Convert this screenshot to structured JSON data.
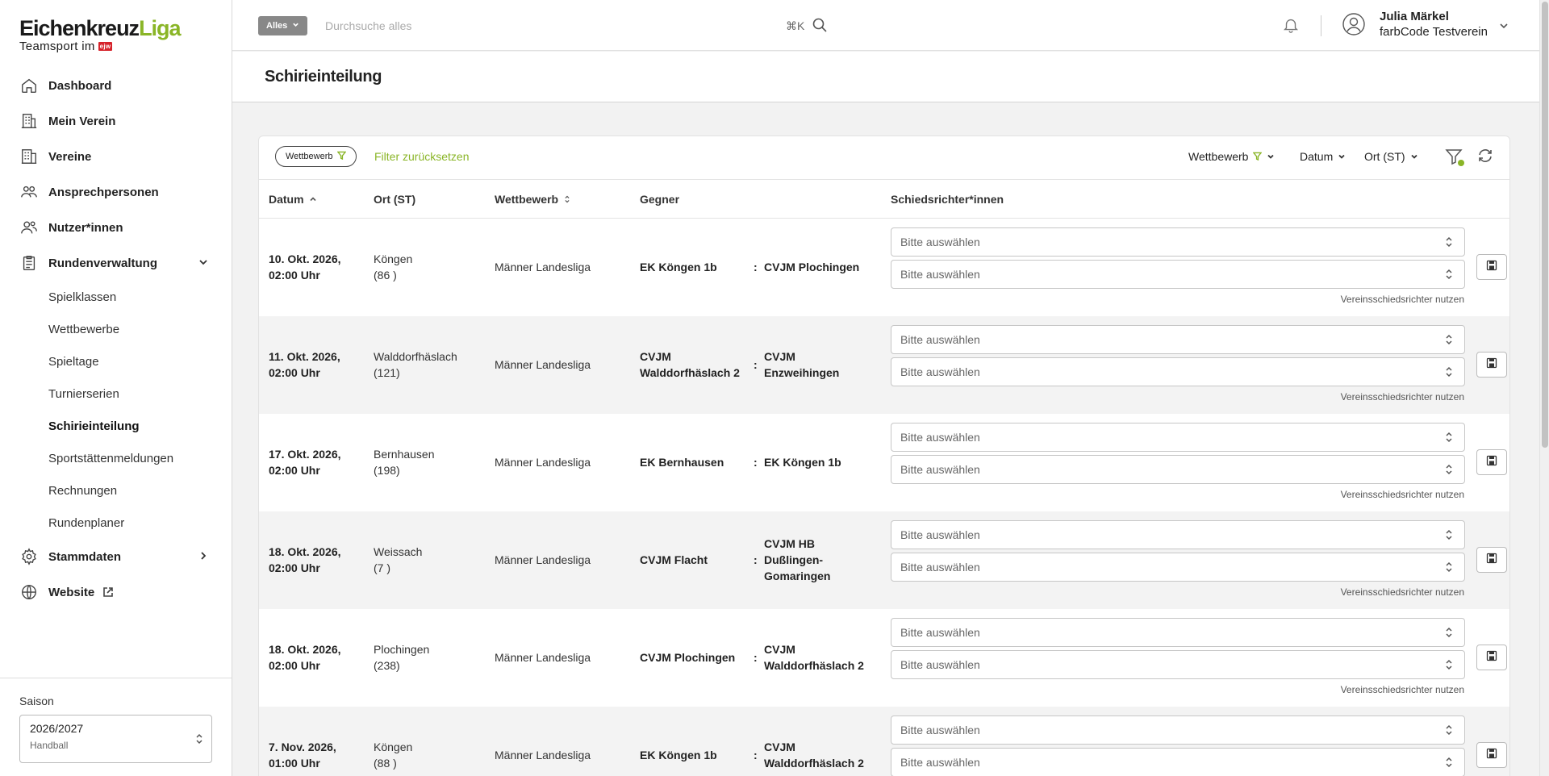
{
  "logo": {
    "brand_a": "Eichenkreuz",
    "brand_b": "Liga",
    "tagline": "Teamsport im",
    "badge": "ejw"
  },
  "nav": {
    "items": [
      {
        "label": "Dashboard",
        "icon": "home-icon"
      },
      {
        "label": "Mein Verein",
        "icon": "building-icon"
      },
      {
        "label": "Vereine",
        "icon": "buildings-icon"
      },
      {
        "label": "Ansprechpersonen",
        "icon": "contacts-icon"
      },
      {
        "label": "Nutzer*innen",
        "icon": "users-icon"
      },
      {
        "label": "Rundenverwaltung",
        "icon": "clipboard-icon"
      }
    ],
    "sub_items": [
      "Spielklassen",
      "Wettbewerbe",
      "Spieltage",
      "Turnierserien",
      "Schirieinteilung",
      "Sportstättenmeldungen",
      "Rechnungen",
      "Rundenplaner"
    ],
    "active_sub": "Schirieinteilung",
    "bottom_items": [
      {
        "label": "Stammdaten",
        "icon": "gear-icon"
      },
      {
        "label": "Website",
        "icon": "globe-icon"
      }
    ]
  },
  "season": {
    "label": "Saison",
    "value": "2026/2027",
    "sub": "Handball"
  },
  "topbar": {
    "scope_label": "Alles",
    "search_placeholder": "Durchsuche alles",
    "shortcut": "⌘K",
    "user_name": "Julia Märkel",
    "user_org": "farbCode Testverein"
  },
  "page": {
    "title": "Schirieinteilung"
  },
  "filters": {
    "chip_label": "Wettbewerb",
    "reset_label": "Filter zurücksetzen",
    "dropdowns": [
      "Wettbewerb",
      "Datum",
      "Ort (ST)"
    ]
  },
  "table": {
    "columns": [
      "Datum",
      "Ort (ST)",
      "Wettbewerb",
      "Gegner",
      "Schiedsrichter*innen"
    ],
    "select_placeholder": "Bitte auswählen",
    "hint": "Vereinsschiedsrichter nutzen",
    "rows": [
      {
        "date": "10. Okt. 2026,\n02:00 Uhr",
        "ort": "Köngen\n(86 )",
        "wettbewerb": "Männer Landesliga",
        "home": "EK Köngen 1b",
        "away": "CVJM Plochingen"
      },
      {
        "date": "11. Okt. 2026,\n02:00 Uhr",
        "ort": "Walddorfhäslach\n(121)",
        "wettbewerb": "Männer Landesliga",
        "home": "CVJM\nWalddorfhäslach 2",
        "away": "CVJM\nEnzweihingen"
      },
      {
        "date": "17. Okt. 2026,\n02:00 Uhr",
        "ort": "Bernhausen\n(198)",
        "wettbewerb": "Männer Landesliga",
        "home": "EK Bernhausen",
        "away": "EK Köngen 1b"
      },
      {
        "date": "18. Okt. 2026,\n02:00 Uhr",
        "ort": "Weissach\n(7 )",
        "wettbewerb": "Männer Landesliga",
        "home": "CVJM Flacht",
        "away": "CVJM HB\nDußlingen-\nGomaringen"
      },
      {
        "date": "18. Okt. 2026,\n02:00 Uhr",
        "ort": "Plochingen\n(238)",
        "wettbewerb": "Männer Landesliga",
        "home": "CVJM Plochingen",
        "away": "CVJM\nWalddorfhäslach 2"
      },
      {
        "date": "7. Nov. 2026,\n01:00 Uhr",
        "ort": "Köngen\n(88 )",
        "wettbewerb": "Männer Landesliga",
        "home": "EK Köngen 1b",
        "away": "CVJM\nWalddorfhäslach 2"
      }
    ]
  },
  "colors": {
    "accent": "#8ab527",
    "badge_red": "#d6232b"
  }
}
